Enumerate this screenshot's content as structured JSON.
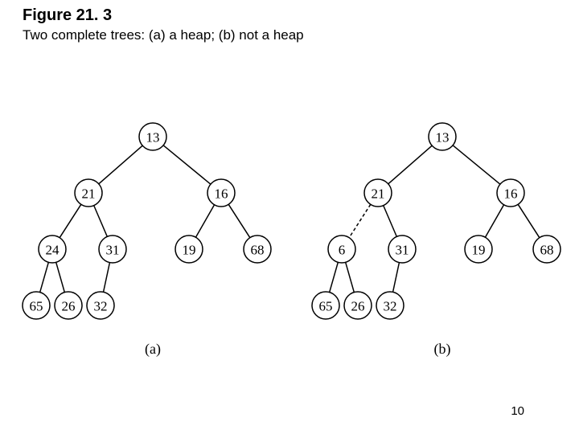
{
  "figure_label": "Figure 21. 3",
  "figure_caption": "Two complete trees: (a) a heap; (b) not a heap",
  "page_number": "10",
  "trees": {
    "a": {
      "caption": "(a)",
      "nodes": {
        "n1": {
          "v": "13"
        },
        "n2": {
          "v": "21"
        },
        "n3": {
          "v": "16"
        },
        "n4": {
          "v": "24"
        },
        "n5": {
          "v": "31"
        },
        "n6": {
          "v": "19"
        },
        "n7": {
          "v": "68"
        },
        "n8": {
          "v": "65"
        },
        "n9": {
          "v": "26"
        },
        "n10": {
          "v": "32"
        }
      },
      "edges": [
        {
          "from": "n1",
          "to": "n2"
        },
        {
          "from": "n1",
          "to": "n3"
        },
        {
          "from": "n2",
          "to": "n4"
        },
        {
          "from": "n2",
          "to": "n5"
        },
        {
          "from": "n3",
          "to": "n6"
        },
        {
          "from": "n3",
          "to": "n7"
        },
        {
          "from": "n4",
          "to": "n8"
        },
        {
          "from": "n4",
          "to": "n9"
        },
        {
          "from": "n5",
          "to": "n10"
        }
      ]
    },
    "b": {
      "caption": "(b)",
      "nodes": {
        "n1": {
          "v": "13"
        },
        "n2": {
          "v": "21"
        },
        "n3": {
          "v": "16"
        },
        "n4": {
          "v": "6"
        },
        "n5": {
          "v": "31"
        },
        "n6": {
          "v": "19"
        },
        "n7": {
          "v": "68"
        },
        "n8": {
          "v": "65"
        },
        "n9": {
          "v": "26"
        },
        "n10": {
          "v": "32"
        }
      },
      "edges": [
        {
          "from": "n1",
          "to": "n2"
        },
        {
          "from": "n1",
          "to": "n3"
        },
        {
          "from": "n2",
          "to": "n4",
          "dashed": true
        },
        {
          "from": "n2",
          "to": "n5"
        },
        {
          "from": "n3",
          "to": "n6"
        },
        {
          "from": "n3",
          "to": "n7"
        },
        {
          "from": "n4",
          "to": "n8"
        },
        {
          "from": "n4",
          "to": "n9"
        },
        {
          "from": "n5",
          "to": "n10"
        }
      ]
    }
  }
}
